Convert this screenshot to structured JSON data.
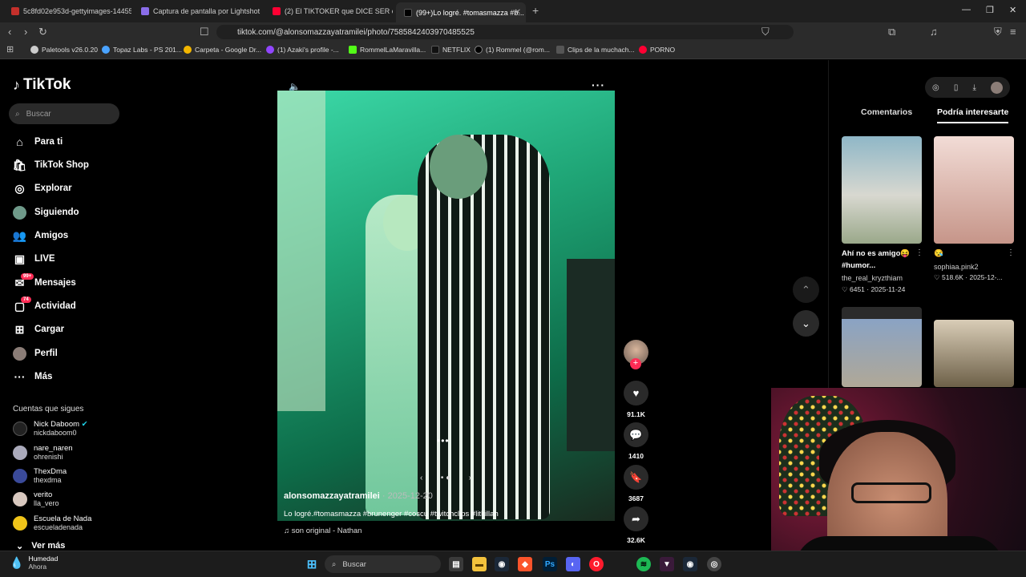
{
  "browser": {
    "tabs": [
      {
        "label": "5c8fd02e953d-gettyimages-144551..."
      },
      {
        "label": "Captura de pantalla por Lightshot"
      },
      {
        "label": "(2) El TIKTOKER que DICE SER el MÁS..."
      },
      {
        "label": "(99+)Lo logré. #tomasmazza #b..."
      }
    ],
    "url": "tiktok.com/@alonsomazzayatramilei/photo/7585842403970485525",
    "bookmarks": [
      {
        "label": "Paletools v26.0.20"
      },
      {
        "label": "Topaz Labs - PS 201..."
      },
      {
        "label": "Carpeta - Google Dr..."
      },
      {
        "label": "(1) Azaki's profile -..."
      },
      {
        "label": "RommelLaMaravilla..."
      },
      {
        "label": "NETFLIX"
      },
      {
        "label": "(1) Rommel (@rom..."
      },
      {
        "label": "Clips de la muchach..."
      },
      {
        "label": "PORNO"
      }
    ]
  },
  "sidebar": {
    "logo": "TikTok",
    "search_placeholder": "Buscar",
    "menu": [
      {
        "label": "Para ti"
      },
      {
        "label": "TikTok Shop"
      },
      {
        "label": "Explorar"
      },
      {
        "label": "Siguiendo"
      },
      {
        "label": "Amigos"
      },
      {
        "label": "LIVE"
      },
      {
        "label": "Mensajes",
        "badge": "99+"
      },
      {
        "label": "Actividad",
        "badge": "74"
      },
      {
        "label": "Cargar"
      },
      {
        "label": "Perfil"
      },
      {
        "label": "Más"
      }
    ],
    "following_title": "Cuentas que sigues",
    "accounts": [
      {
        "name": "Nick Daboom",
        "handle": "nickdaboom0"
      },
      {
        "name": "nare_naren",
        "handle": "ohrenishi"
      },
      {
        "name": "ThexDma",
        "handle": "thexdma"
      },
      {
        "name": "verito",
        "handle": "lla_vero"
      },
      {
        "name": "Escuela de Nada",
        "handle": "escueladenada"
      }
    ],
    "see_more": "Ver más"
  },
  "post": {
    "username": "alonsomazzayatramilei",
    "date": "2025-12-20",
    "caption": "Lo logré.#tomasmazza #brunenger #coscu #twitchclips #litkillah",
    "sound": "son original - Nathan",
    "likes": "91.1K",
    "comments": "1410",
    "saves": "3687",
    "shares": "32.6K"
  },
  "right_panel": {
    "tabs": [
      {
        "label": "Comentarios"
      },
      {
        "label": "Podría interesarte"
      }
    ],
    "videos": [
      {
        "title": "Ahí no es amigo😝 #humor...",
        "user": "the_real_kryzthiam",
        "stats": "6451 · 2025-11-24"
      },
      {
        "title": "😪",
        "user": "sophiaa.pink2",
        "stats": "518.6K · 2025-12-..."
      }
    ]
  },
  "taskbar": {
    "weather_title": "Humedad",
    "weather_sub": "Ahora",
    "search": "Buscar"
  },
  "colors": {
    "accent": "#fe2c55",
    "bg": "#000000"
  }
}
